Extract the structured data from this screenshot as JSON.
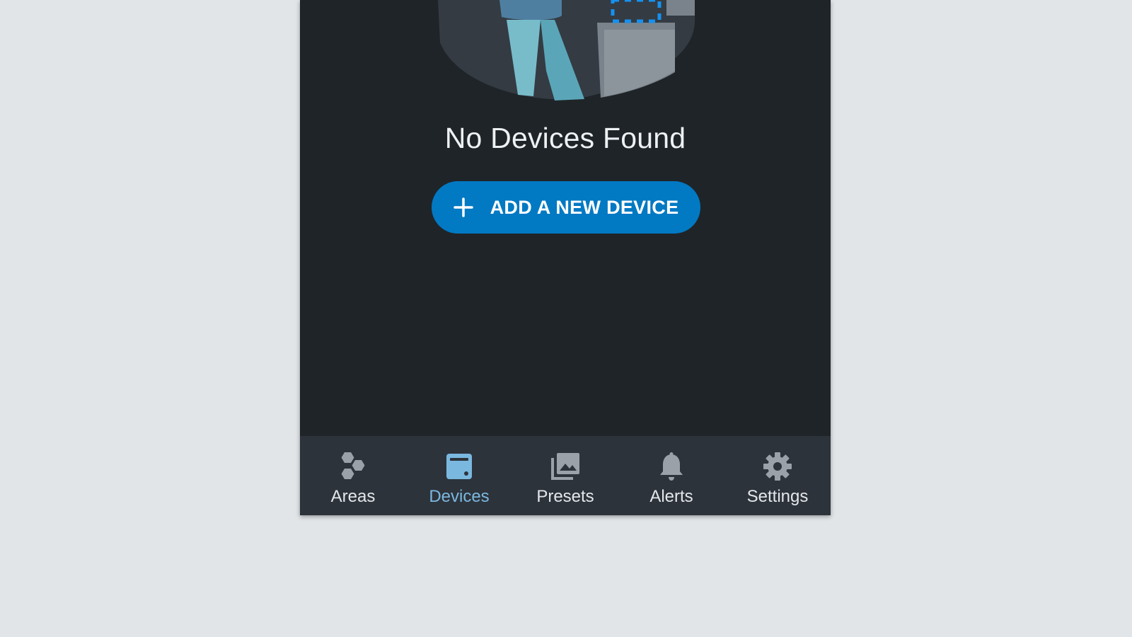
{
  "empty_state": {
    "title": "No Devices Found",
    "add_button_label": "ADD A NEW DEVICE"
  },
  "nav": {
    "items": [
      {
        "label": "Areas",
        "icon": "hexagons-icon",
        "active": false
      },
      {
        "label": "Devices",
        "icon": "device-icon",
        "active": true
      },
      {
        "label": "Presets",
        "icon": "image-stack-icon",
        "active": false
      },
      {
        "label": "Alerts",
        "icon": "bell-icon",
        "active": false
      },
      {
        "label": "Settings",
        "icon": "gear-icon",
        "active": false
      }
    ]
  },
  "colors": {
    "background": "#1f2428",
    "accent": "#0279c3",
    "active_tab": "#7ab8e0",
    "nav_background": "#2d333b"
  }
}
